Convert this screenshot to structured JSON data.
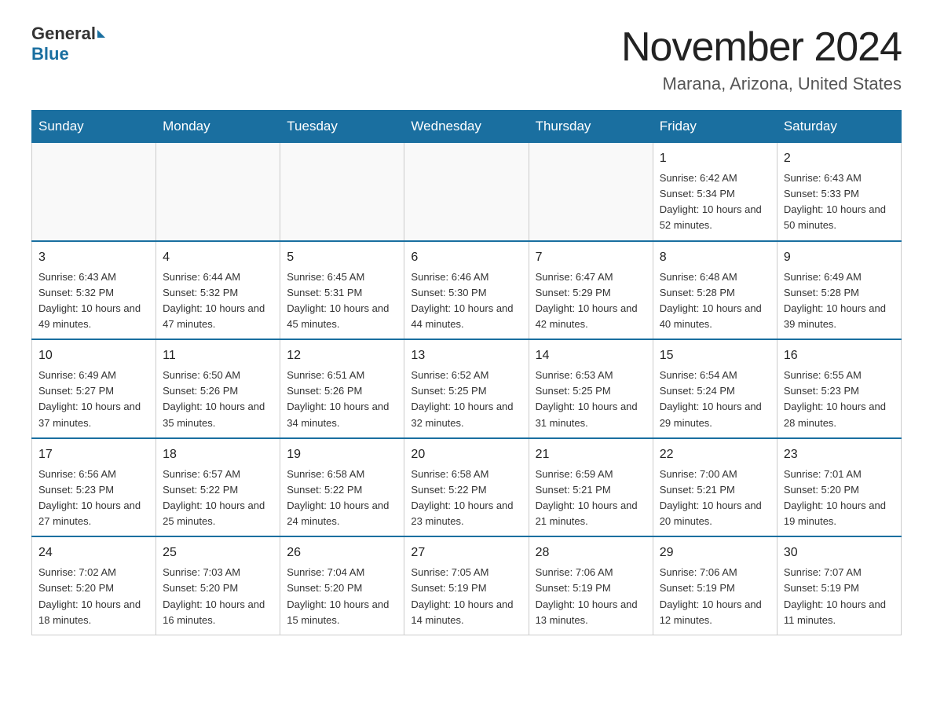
{
  "header": {
    "logo_general": "General",
    "logo_blue": "Blue",
    "month_title": "November 2024",
    "location": "Marana, Arizona, United States"
  },
  "weekdays": [
    "Sunday",
    "Monday",
    "Tuesday",
    "Wednesday",
    "Thursday",
    "Friday",
    "Saturday"
  ],
  "weeks": [
    [
      {
        "day": "",
        "info": ""
      },
      {
        "day": "",
        "info": ""
      },
      {
        "day": "",
        "info": ""
      },
      {
        "day": "",
        "info": ""
      },
      {
        "day": "",
        "info": ""
      },
      {
        "day": "1",
        "info": "Sunrise: 6:42 AM\nSunset: 5:34 PM\nDaylight: 10 hours and 52 minutes."
      },
      {
        "day": "2",
        "info": "Sunrise: 6:43 AM\nSunset: 5:33 PM\nDaylight: 10 hours and 50 minutes."
      }
    ],
    [
      {
        "day": "3",
        "info": "Sunrise: 6:43 AM\nSunset: 5:32 PM\nDaylight: 10 hours and 49 minutes."
      },
      {
        "day": "4",
        "info": "Sunrise: 6:44 AM\nSunset: 5:32 PM\nDaylight: 10 hours and 47 minutes."
      },
      {
        "day": "5",
        "info": "Sunrise: 6:45 AM\nSunset: 5:31 PM\nDaylight: 10 hours and 45 minutes."
      },
      {
        "day": "6",
        "info": "Sunrise: 6:46 AM\nSunset: 5:30 PM\nDaylight: 10 hours and 44 minutes."
      },
      {
        "day": "7",
        "info": "Sunrise: 6:47 AM\nSunset: 5:29 PM\nDaylight: 10 hours and 42 minutes."
      },
      {
        "day": "8",
        "info": "Sunrise: 6:48 AM\nSunset: 5:28 PM\nDaylight: 10 hours and 40 minutes."
      },
      {
        "day": "9",
        "info": "Sunrise: 6:49 AM\nSunset: 5:28 PM\nDaylight: 10 hours and 39 minutes."
      }
    ],
    [
      {
        "day": "10",
        "info": "Sunrise: 6:49 AM\nSunset: 5:27 PM\nDaylight: 10 hours and 37 minutes."
      },
      {
        "day": "11",
        "info": "Sunrise: 6:50 AM\nSunset: 5:26 PM\nDaylight: 10 hours and 35 minutes."
      },
      {
        "day": "12",
        "info": "Sunrise: 6:51 AM\nSunset: 5:26 PM\nDaylight: 10 hours and 34 minutes."
      },
      {
        "day": "13",
        "info": "Sunrise: 6:52 AM\nSunset: 5:25 PM\nDaylight: 10 hours and 32 minutes."
      },
      {
        "day": "14",
        "info": "Sunrise: 6:53 AM\nSunset: 5:25 PM\nDaylight: 10 hours and 31 minutes."
      },
      {
        "day": "15",
        "info": "Sunrise: 6:54 AM\nSunset: 5:24 PM\nDaylight: 10 hours and 29 minutes."
      },
      {
        "day": "16",
        "info": "Sunrise: 6:55 AM\nSunset: 5:23 PM\nDaylight: 10 hours and 28 minutes."
      }
    ],
    [
      {
        "day": "17",
        "info": "Sunrise: 6:56 AM\nSunset: 5:23 PM\nDaylight: 10 hours and 27 minutes."
      },
      {
        "day": "18",
        "info": "Sunrise: 6:57 AM\nSunset: 5:22 PM\nDaylight: 10 hours and 25 minutes."
      },
      {
        "day": "19",
        "info": "Sunrise: 6:58 AM\nSunset: 5:22 PM\nDaylight: 10 hours and 24 minutes."
      },
      {
        "day": "20",
        "info": "Sunrise: 6:58 AM\nSunset: 5:22 PM\nDaylight: 10 hours and 23 minutes."
      },
      {
        "day": "21",
        "info": "Sunrise: 6:59 AM\nSunset: 5:21 PM\nDaylight: 10 hours and 21 minutes."
      },
      {
        "day": "22",
        "info": "Sunrise: 7:00 AM\nSunset: 5:21 PM\nDaylight: 10 hours and 20 minutes."
      },
      {
        "day": "23",
        "info": "Sunrise: 7:01 AM\nSunset: 5:20 PM\nDaylight: 10 hours and 19 minutes."
      }
    ],
    [
      {
        "day": "24",
        "info": "Sunrise: 7:02 AM\nSunset: 5:20 PM\nDaylight: 10 hours and 18 minutes."
      },
      {
        "day": "25",
        "info": "Sunrise: 7:03 AM\nSunset: 5:20 PM\nDaylight: 10 hours and 16 minutes."
      },
      {
        "day": "26",
        "info": "Sunrise: 7:04 AM\nSunset: 5:20 PM\nDaylight: 10 hours and 15 minutes."
      },
      {
        "day": "27",
        "info": "Sunrise: 7:05 AM\nSunset: 5:19 PM\nDaylight: 10 hours and 14 minutes."
      },
      {
        "day": "28",
        "info": "Sunrise: 7:06 AM\nSunset: 5:19 PM\nDaylight: 10 hours and 13 minutes."
      },
      {
        "day": "29",
        "info": "Sunrise: 7:06 AM\nSunset: 5:19 PM\nDaylight: 10 hours and 12 minutes."
      },
      {
        "day": "30",
        "info": "Sunrise: 7:07 AM\nSunset: 5:19 PM\nDaylight: 10 hours and 11 minutes."
      }
    ]
  ]
}
